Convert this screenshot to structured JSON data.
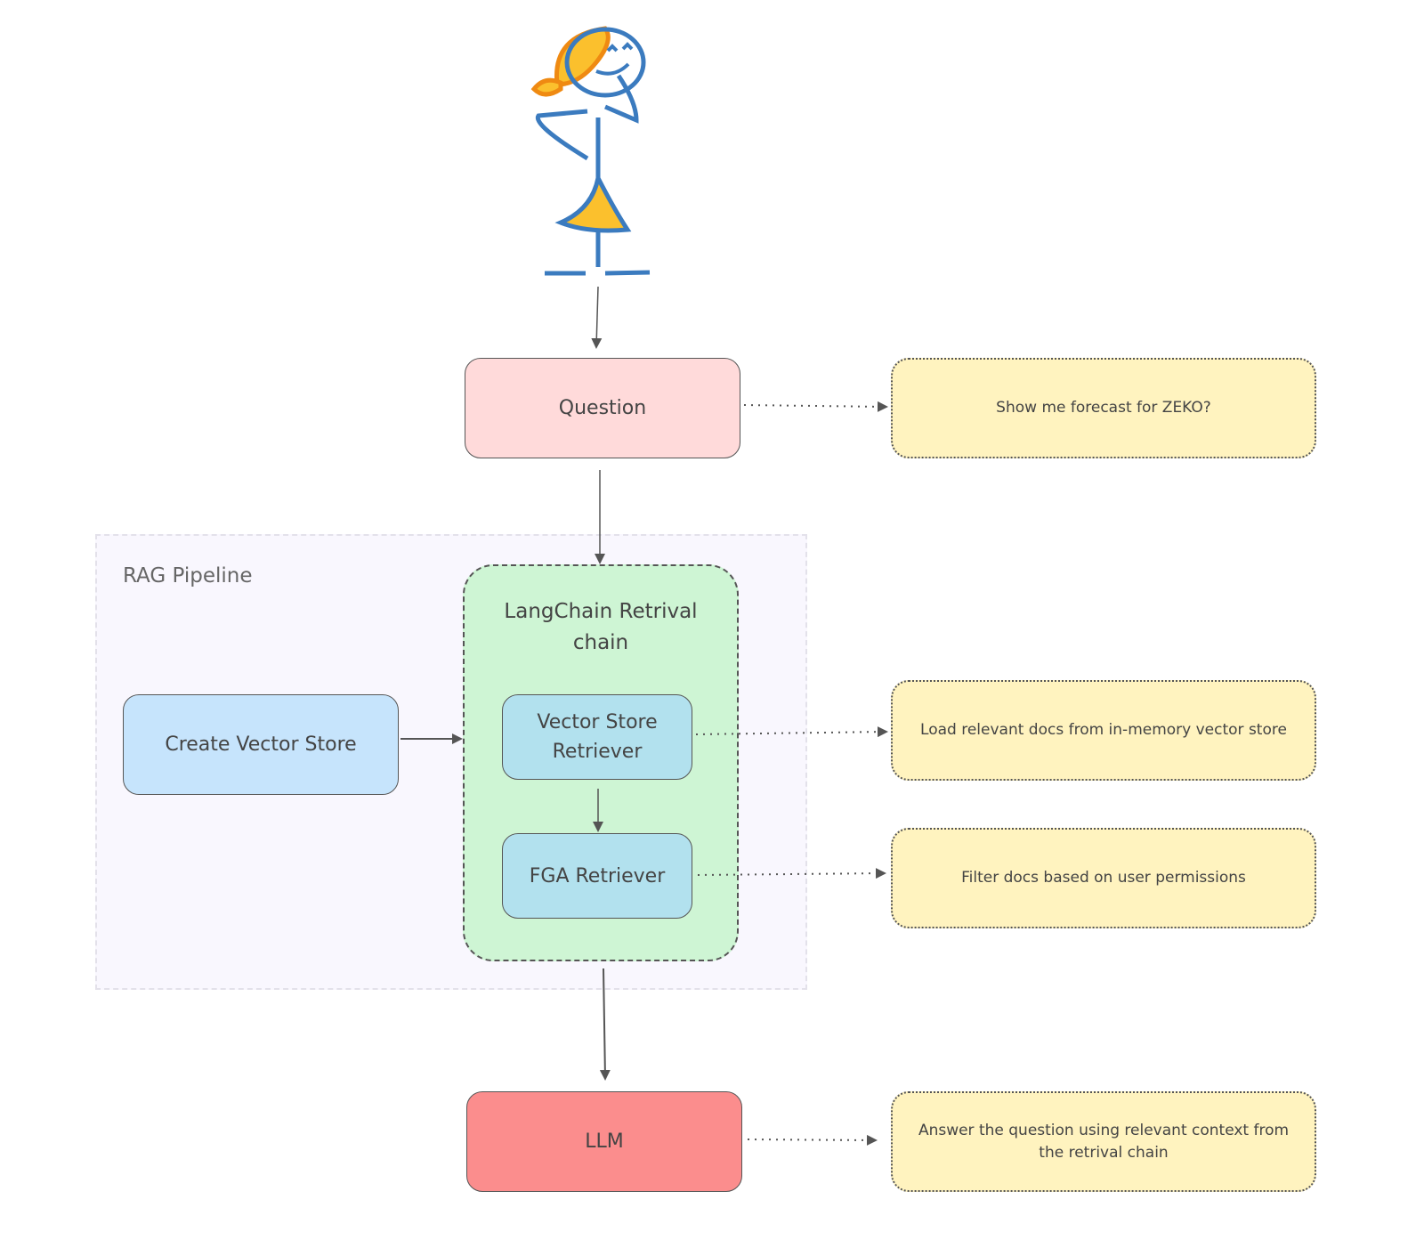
{
  "diagram": {
    "group": {
      "label": "RAG Pipeline"
    },
    "nodes": {
      "question": {
        "label": "Question",
        "color": "#ffdada"
      },
      "retrieval_chain": {
        "label": "LangChain Retrival chain",
        "color": "#cef5d4"
      },
      "vector_store_retriever": {
        "label": "Vector Store Retriever",
        "color": "#b2e1ee"
      },
      "fga_retriever": {
        "label": "FGA Retriever",
        "color": "#b2e1ee"
      },
      "create_vector_store": {
        "label": "Create Vector Store",
        "color": "#c6e4fc"
      },
      "llm": {
        "label": "LLM",
        "color": "#fb8d8d"
      }
    },
    "notes": {
      "question_note": "Show me forecast for ZEKO?",
      "vector_note": "Load relevant docs from in-memory vector store",
      "fga_note": "Filter docs based on user permissions",
      "llm_note": "Answer the question using relevant context from the retrival chain"
    },
    "actor": {
      "icon": "user-figure-icon"
    }
  }
}
